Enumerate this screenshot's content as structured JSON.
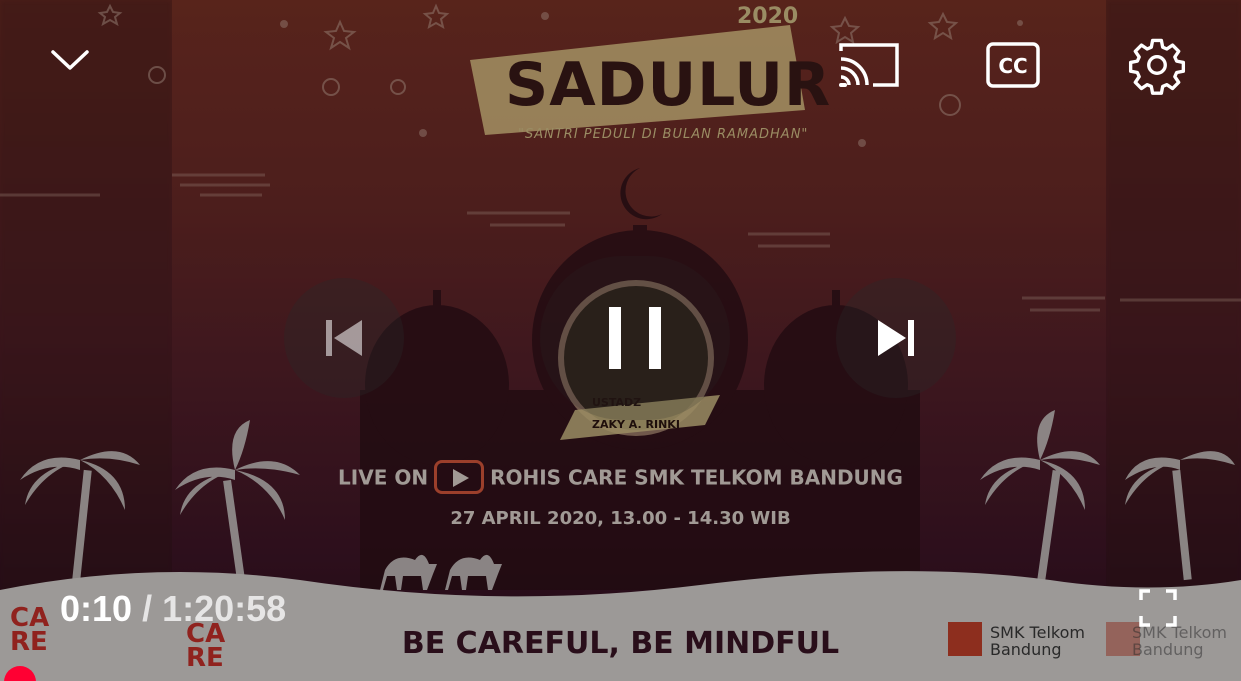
{
  "player": {
    "state": "playing",
    "current_time": "0:10",
    "separator": "/",
    "duration": "1:20:58",
    "progress": 0.002,
    "accent_color": "#ff0033"
  },
  "controls": {
    "minimize_icon": "chevron-down-icon",
    "cast_icon": "cast-icon",
    "captions_icon": "cc-icon",
    "captions_label": "CC",
    "settings_icon": "gear-icon",
    "previous_icon": "skip-previous-icon",
    "pause_icon": "pause-icon",
    "next_icon": "skip-next-icon",
    "fullscreen_icon": "fullscreen-icon"
  },
  "poster": {
    "year": "2020",
    "title": "SADULUR",
    "subtitle": "\"SANTRI PEDULI DI BULAN RAMADHAN\"",
    "speaker_label": "USTADZ",
    "speaker_name": "ZAKY A. RINKI",
    "live_prefix": "LIVE ON",
    "live_channel": "ROHIS CARE SMK TELKOM BANDUNG",
    "schedule": "27 APRIL 2020, 13.00 - 14.30 WIB",
    "slogan": "BE CAREFUL, BE MINDFUL",
    "school_line1": "SMK Telkom",
    "school_line2": "Bandung",
    "care_logo_line1": "CA",
    "care_logo_line2": "RE"
  }
}
